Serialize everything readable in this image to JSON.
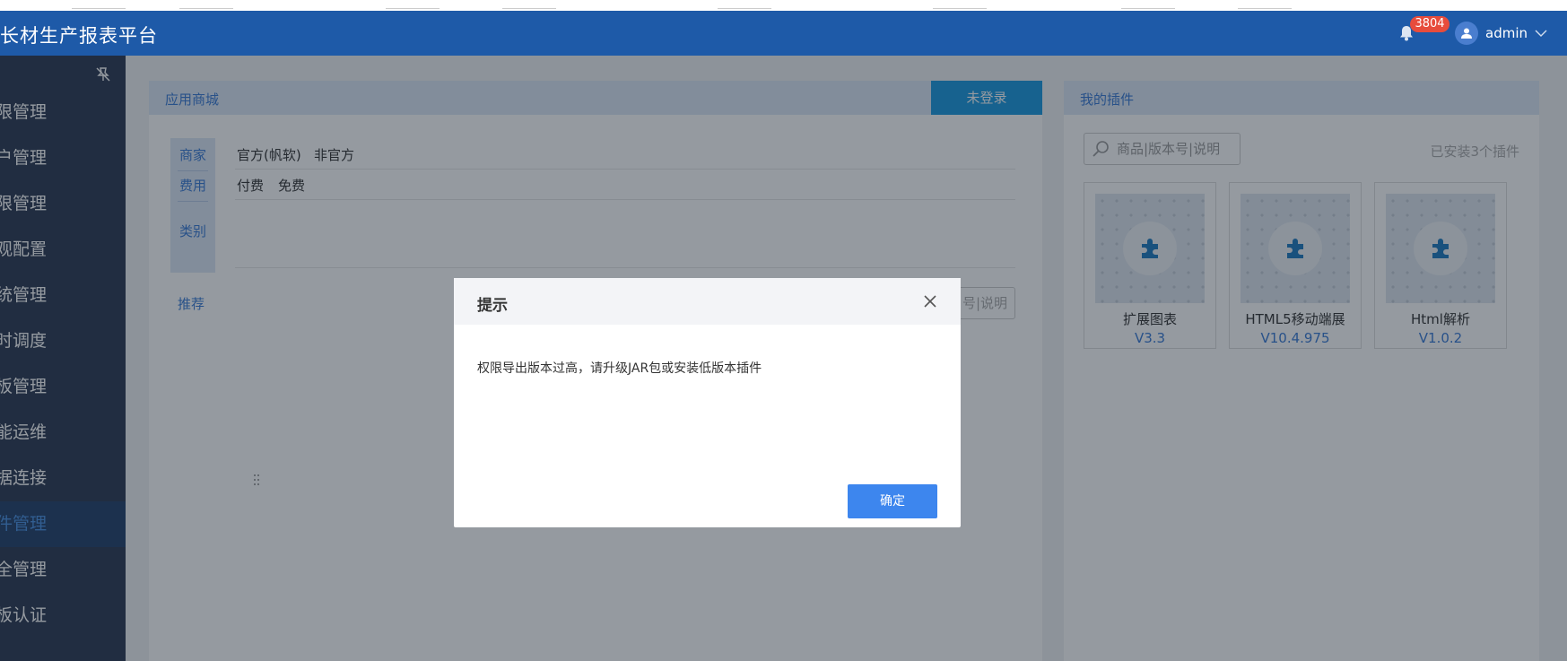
{
  "header": {
    "app_title": "长材生产报表平台",
    "notification_count": "3804",
    "user_name": "admin"
  },
  "sidebar": {
    "items": [
      {
        "label": "权限管理"
      },
      {
        "label": "用户管理"
      },
      {
        "label": "权限管理"
      },
      {
        "label": "外观配置"
      },
      {
        "label": "系统管理"
      },
      {
        "label": "定时调度"
      },
      {
        "label": "模板管理"
      },
      {
        "label": "智能运维"
      },
      {
        "label": "数据连接"
      },
      {
        "label": "插件管理"
      },
      {
        "label": "安全管理"
      },
      {
        "label": "模板认证"
      }
    ],
    "active_index": 9
  },
  "app_store": {
    "title": "应用商城",
    "login_button": "未登录",
    "filters": {
      "tab_vendor": "商家",
      "tab_fee": "费用",
      "tab_category": "类别",
      "vendor_official": "官方(帆软)",
      "vendor_unofficial": "非官方",
      "fee_paid": "付费",
      "fee_free": "免费"
    },
    "recommend": "推荐",
    "search_fragment": "号|说明"
  },
  "my_plugins": {
    "title": "我的插件",
    "search_placeholder": "商品|版本号|说明",
    "installed_note": "已安装3个插件",
    "plugins": [
      {
        "name": "扩展图表",
        "version": "V3.3"
      },
      {
        "name": "HTML5移动端展",
        "version": "V10.4.975"
      },
      {
        "name": "Html解析",
        "version": "V1.0.2"
      }
    ]
  },
  "dialog": {
    "title": "提示",
    "message": "权限导出版本过高，请升级JAR包或安装低版本插件",
    "ok_label": "确定"
  },
  "colors": {
    "header_bg": "#1e5aa8",
    "sidebar_bg": "#2c3a52",
    "accent": "#3a7bd5",
    "primary_button": "#3d86ee",
    "badge": "#e74c3c"
  }
}
